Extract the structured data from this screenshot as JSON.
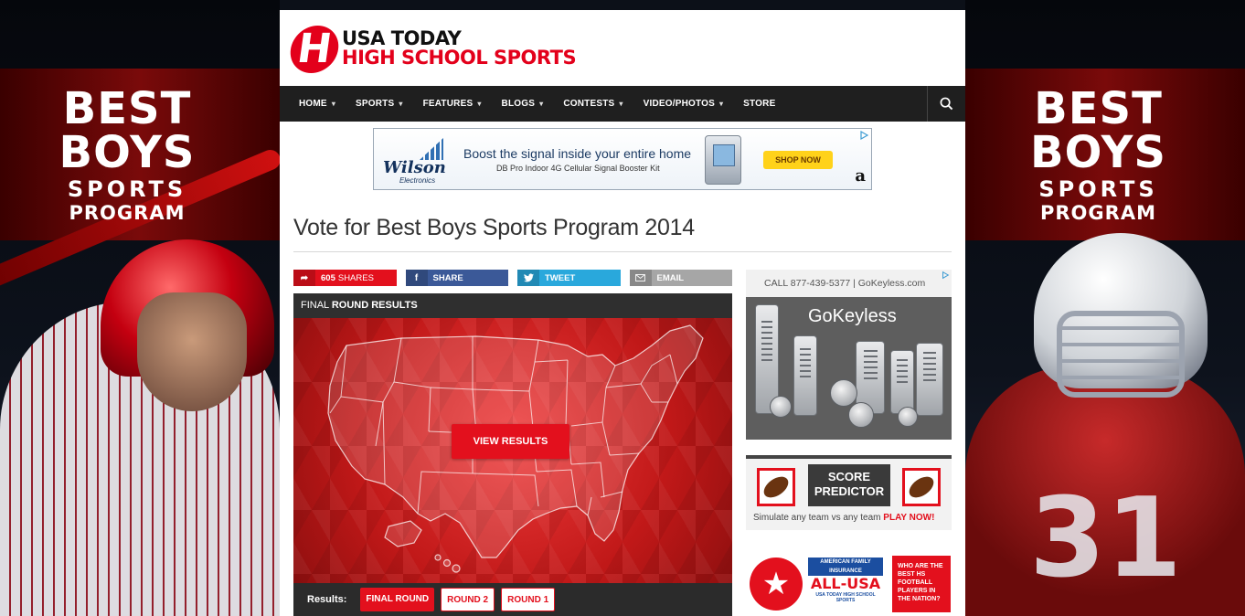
{
  "skin": {
    "left": {
      "line1": "BEST",
      "line2": "BOYS",
      "line3": "SPORTS",
      "line4": "PROGRAM"
    },
    "right": {
      "line1": "BEST",
      "line2": "BOYS",
      "line3": "SPORTS",
      "line4": "PROGRAM",
      "jersey_number": "31"
    }
  },
  "header": {
    "logo_letter": "H",
    "logo_line1": "USA TODAY",
    "logo_line2": "HIGH SCHOOL SPORTS"
  },
  "nav": {
    "items": [
      {
        "label": "HOME",
        "dropdown": true
      },
      {
        "label": "SPORTS",
        "dropdown": true
      },
      {
        "label": "FEATURES",
        "dropdown": true
      },
      {
        "label": "BLOGS",
        "dropdown": true
      },
      {
        "label": "CONTESTS",
        "dropdown": true
      },
      {
        "label": "VIDEO/PHOTOS",
        "dropdown": true
      },
      {
        "label": "STORE",
        "dropdown": false
      }
    ],
    "chevron": "▾",
    "search_icon": "search-icon"
  },
  "banner_ad": {
    "brand": "Wilson",
    "brand_sub": "Electronics",
    "headline": "Boost the signal inside your entire home",
    "subline": "DB Pro Indoor 4G Cellular Signal Booster Kit",
    "cta": "SHOP NOW",
    "amazon_mark": "a"
  },
  "page": {
    "title": "Vote for Best Boys Sports Program 2014"
  },
  "share": {
    "count": "605",
    "count_label": "SHARES",
    "facebook": "SHARE",
    "twitter": "TWEET",
    "email": "EMAIL",
    "colors": {
      "count": "#e3101d",
      "facebook": "#3b5998",
      "twitter": "#29a8dc",
      "email": "#a6a6a6"
    }
  },
  "results_panel": {
    "header_prefix": "FINAL",
    "header_bold": "ROUND RESULTS",
    "view_button": "VIEW RESULTS",
    "results_label": "Results:",
    "rounds": [
      {
        "label": "FINAL ROUND",
        "active": true
      },
      {
        "label": "ROUND 2",
        "active": false
      },
      {
        "label": "ROUND 1",
        "active": false
      }
    ]
  },
  "sidebar": {
    "keyless_ad": {
      "top_text": "CALL 877-439-5377  |  GoKeyless.com",
      "brand": "GoKeyless"
    },
    "score_predictor": {
      "title_line1": "SCORE",
      "title_line2": "PREDICTOR",
      "sub_text": "Simulate any team vs any team",
      "cta": "PLAY NOW!"
    },
    "all_usa": {
      "ins_line1": "AMERICAN FAMILY",
      "ins_line2": "INSURANCE",
      "title": "ALL-USA",
      "tag": "USA TODAY HIGH SCHOOL SPORTS",
      "question": "WHO ARE THE BEST HS FOOTBALL PLAYERS IN THE NATION?"
    }
  },
  "accent_color": "#e3101d"
}
